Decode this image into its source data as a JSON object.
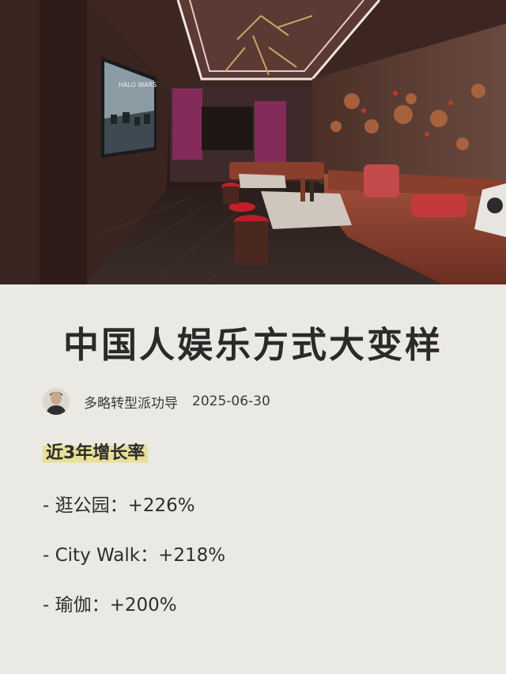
{
  "post": {
    "title": "中国人娱乐方式大变样",
    "author": "多略转型派功导",
    "date": "2025-06-30",
    "section_heading": "近3年增长率",
    "stats": [
      "- 逛公园：+226%",
      "- City Walk：+218%",
      "- 瑜伽：+200%"
    ]
  },
  "hero": {
    "tv_text": "HALO WARS",
    "description_icon": "karaoke-room-photo"
  },
  "colors": {
    "background": "#ebe9e4",
    "highlight": "#e8df9a",
    "title": "#2a2a2a"
  }
}
